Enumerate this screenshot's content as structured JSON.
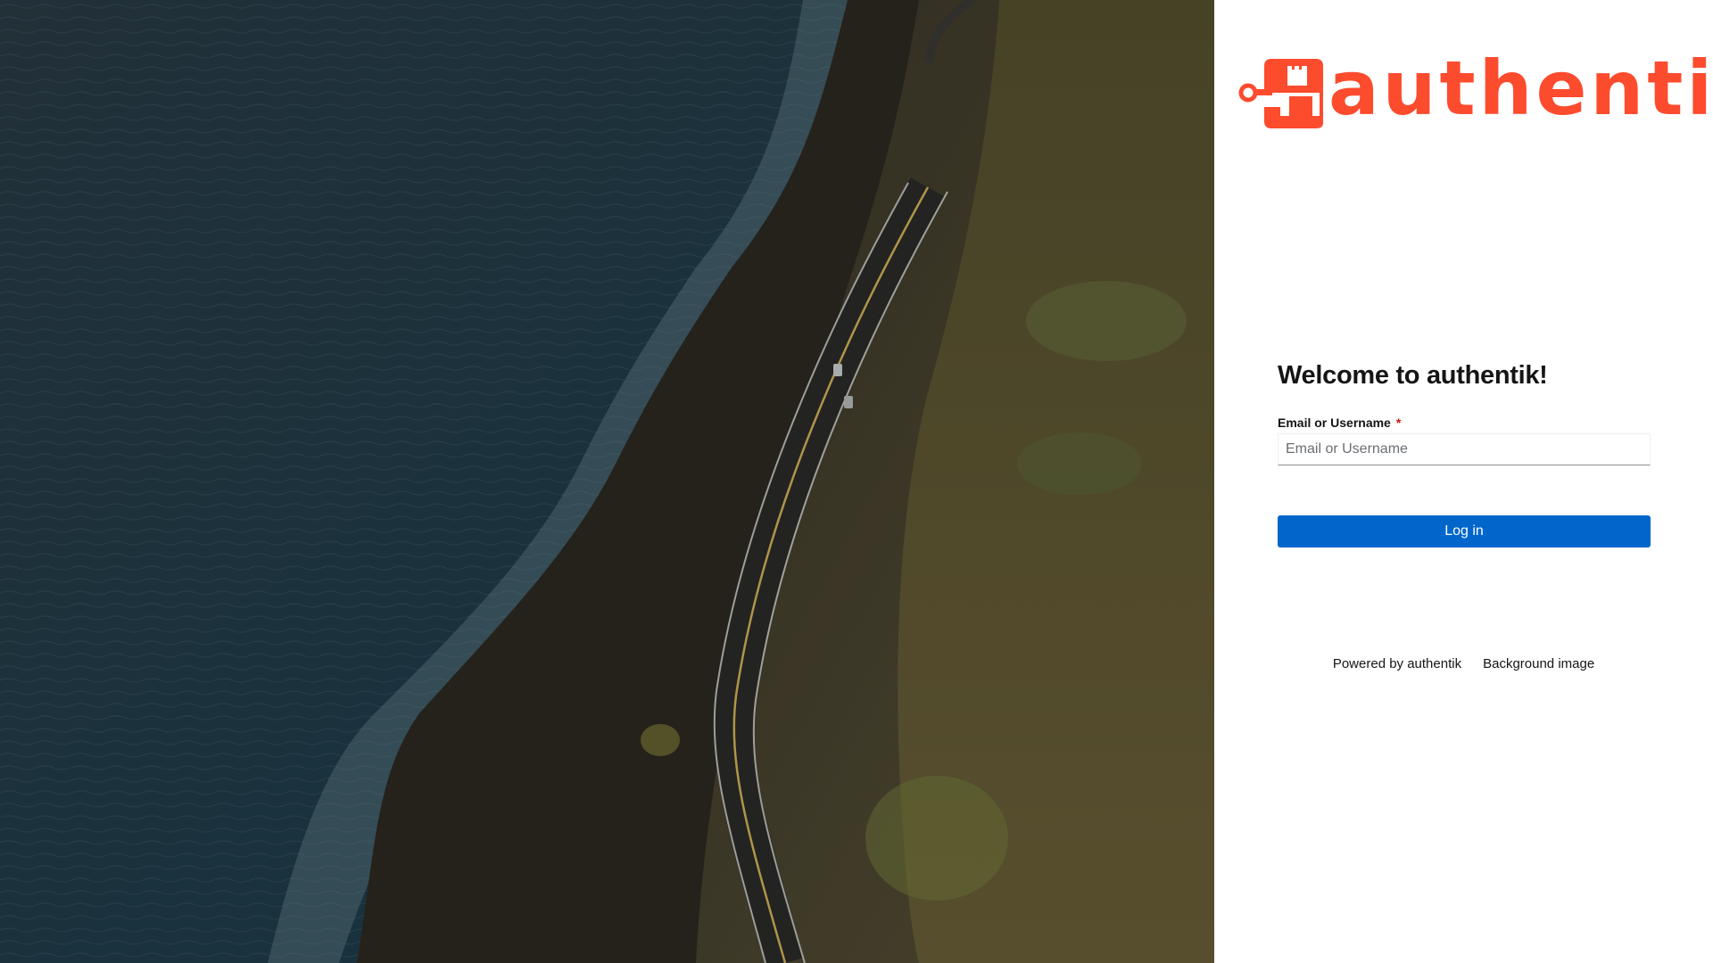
{
  "brand": {
    "name": "authentik",
    "accent_color": "#fd4b2d"
  },
  "background": {
    "description_icon": "coastal-road-aerial-photo"
  },
  "login": {
    "title": "Welcome to authentik!",
    "field_label": "Email or Username",
    "required_marker": "*",
    "input_value": "",
    "input_placeholder": "Email or Username",
    "button_label": "Log in",
    "button_color": "#0066cc",
    "required_color": "#c9190b"
  },
  "footer": {
    "links": [
      {
        "label": "Powered by authentik"
      },
      {
        "label": "Background image"
      }
    ]
  }
}
